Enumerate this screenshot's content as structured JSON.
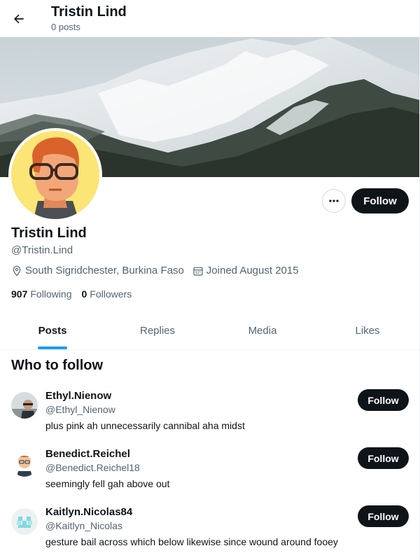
{
  "header": {
    "title": "Tristin Lind",
    "post_count": "0 posts"
  },
  "profile": {
    "name": "Tristin Lind",
    "handle": "@Tristin.Lind",
    "location": "South Sigridchester, Burkina Faso",
    "joined": "Joined August 2015",
    "following_count": "907",
    "following_label": "Following",
    "followers_count": "0",
    "followers_label": "Followers",
    "more_label": "···",
    "follow_label": "Follow"
  },
  "tabs": [
    {
      "label": "Posts",
      "active": true
    },
    {
      "label": "Replies",
      "active": false
    },
    {
      "label": "Media",
      "active": false
    },
    {
      "label": "Likes",
      "active": false
    }
  ],
  "who_to_follow": {
    "title": "Who to follow",
    "items": [
      {
        "name": "Ethyl.Nienow",
        "handle": "@Ethyl_Nienow",
        "bio": "plus pink ah unnecessarily cannibal aha midst",
        "button": "Follow"
      },
      {
        "name": "Benedict.Reichel",
        "handle": "@Benedict.Reichel18",
        "bio": "seemingly fell gah above out",
        "button": "Follow"
      },
      {
        "name": "Kaitlyn.Nicolas84",
        "handle": "@Kaitlyn_Nicolas",
        "bio": "gesture bail across which below likewise since wound around fooey",
        "button": "Follow"
      }
    ]
  },
  "colors": {
    "accent": "#1d9bf0",
    "primary_button": "#0f1419",
    "secondary_text": "#536471"
  },
  "icons": [
    "back-arrow-icon",
    "more-icon",
    "location-pin-icon",
    "calendar-icon"
  ]
}
